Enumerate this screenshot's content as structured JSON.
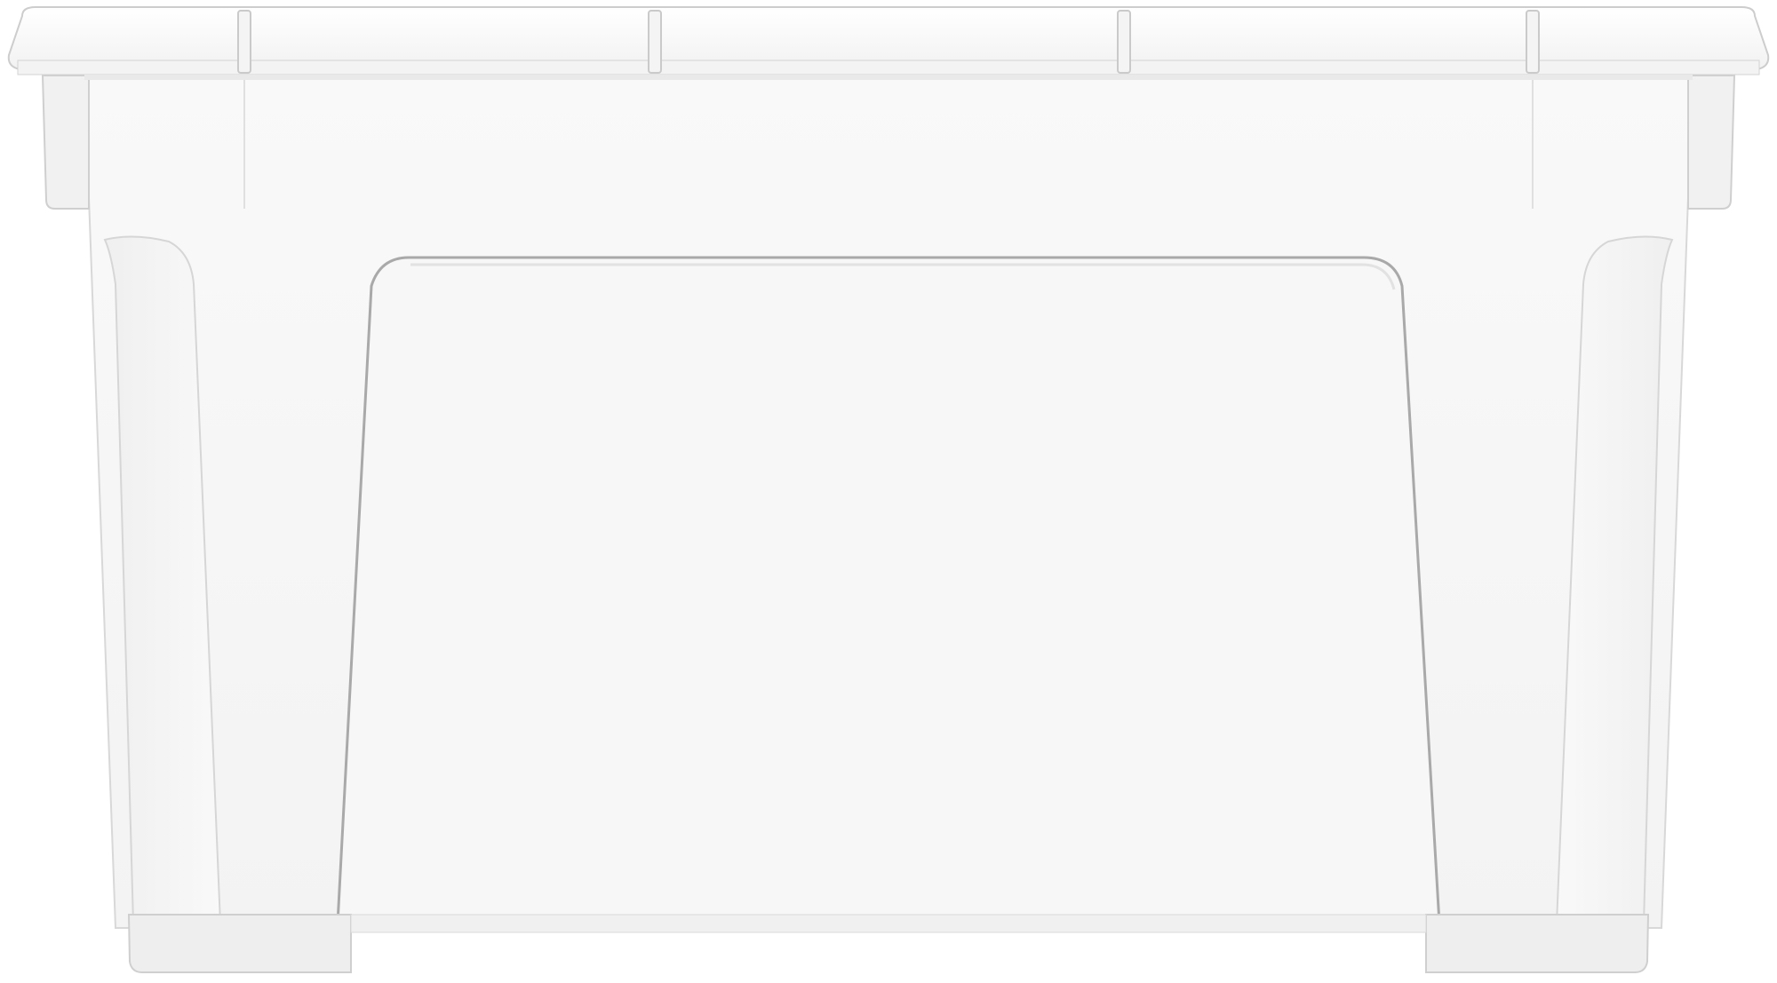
{
  "scene": {
    "subject": "clear-plastic-storage-box",
    "colors": {
      "background": "#ffffff",
      "body": "#f6f6f6",
      "lid": "#fbfbfb",
      "edge": "#c9c9c9",
      "panel_edge": "#a9a9a9",
      "shadow": "#e7e7e7"
    }
  }
}
